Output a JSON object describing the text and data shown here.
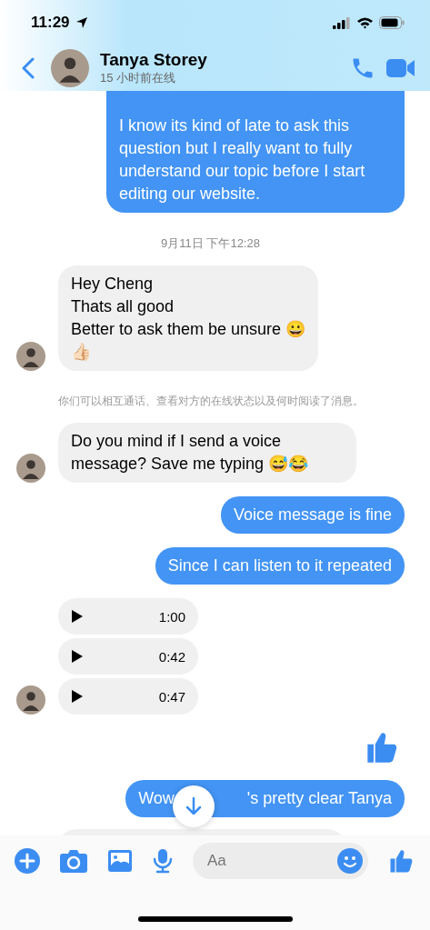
{
  "status_bar": {
    "time": "11:29"
  },
  "header": {
    "name": "Tanya Storey",
    "presence": "15 小时前在线"
  },
  "messages": [
    {
      "kind": "sent",
      "cut_top": true,
      "text": "I know its kind of late to ask this question but I really  want to fully understand our topic before I start editing our website."
    },
    {
      "kind": "timestamp",
      "text": "9月11日 下午12:28"
    },
    {
      "kind": "received",
      "avatar": true,
      "text": "Hey Cheng\nThats all good\nBetter to ask them be unsure 😀\n👍🏻"
    },
    {
      "kind": "notice",
      "text": "你们可以相互通话、查看对方的在线状态以及何时阅读了消息。"
    },
    {
      "kind": "received",
      "avatar": true,
      "text": "Do you mind if I send a voice message? Save me typing 😅😂"
    },
    {
      "kind": "sent",
      "text": "Voice message is fine"
    },
    {
      "kind": "sent",
      "text": "Since I can listen to it repeated"
    },
    {
      "kind": "voice",
      "avatar": true,
      "clips": [
        {
          "duration": "1:00"
        },
        {
          "duration": "0:42"
        },
        {
          "duration": "0:47"
        }
      ]
    },
    {
      "kind": "like"
    },
    {
      "kind": "covered",
      "text_before": "Wow",
      "text_after": "'s pretty clear Tanya"
    },
    {
      "kind": "partial"
    }
  ],
  "composer": {
    "placeholder": "Aa"
  }
}
